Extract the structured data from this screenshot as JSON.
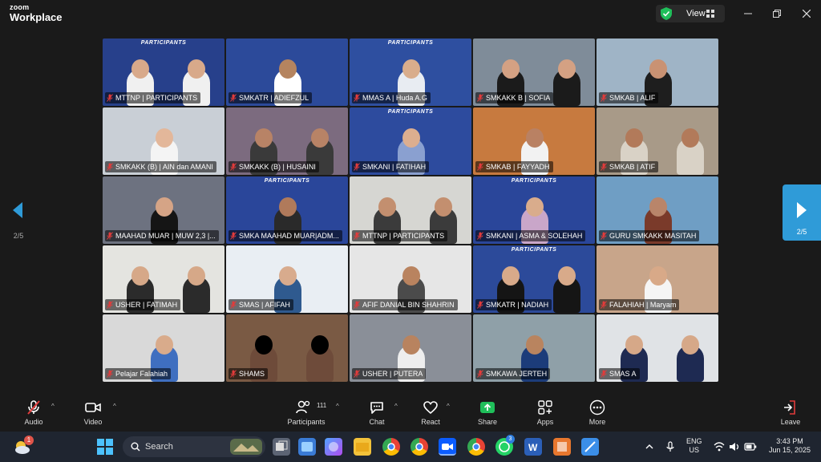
{
  "window": {
    "brand_top": "zoom",
    "brand_bottom": "Workplace",
    "view_label": "View",
    "colors": {
      "bg": "#1a1a1a",
      "accent": "#2f9bd8",
      "share": "#1fbf5a",
      "muted": "#e23b3b"
    }
  },
  "nav": {
    "left_count": "2/5",
    "right_count": "2/5"
  },
  "tiles": [
    {
      "name": "MTTNP | PARTICIPANTS",
      "bg": "#27408b",
      "skin": "#d8a98a",
      "wear": "#f0f0f0",
      "banner": "PARTICIPANTS"
    },
    {
      "name": "SMKATR | ADIEFZUL",
      "bg": "#2c4a9a",
      "skin": "#b5845f",
      "wear": "#ffffff",
      "banner": ""
    },
    {
      "name": "MMAS A | Huda A.G",
      "bg": "#2e4fa0",
      "skin": "#d9ad8c",
      "wear": "#e8ecf2",
      "banner": "PARTICIPANTS"
    },
    {
      "name": "SMKAKK B | SOFIA",
      "bg": "#7f8c99",
      "skin": "#d4a183",
      "wear": "#1b1b1b",
      "banner": ""
    },
    {
      "name": "SMKAB | ALIF",
      "bg": "#9fb4c6",
      "skin": "#c99273",
      "wear": "#1e1e1e",
      "banner": ""
    },
    {
      "name": "SMKAKK (B) | AIN dan AMANI",
      "bg": "#c9cfd6",
      "skin": "#e3b79a",
      "wear": "#f4f4f4",
      "banner": ""
    },
    {
      "name": "SMKAKK (B) | HUSAINI",
      "bg": "#7c6b7f",
      "skin": "#b88366",
      "wear": "#3a3a3a",
      "banner": ""
    },
    {
      "name": "SMKANI | FATIHAH",
      "bg": "#2d4b9e",
      "skin": "#dcae8f",
      "wear": "#8aa0d0",
      "banner": "PARTICIPANTS"
    },
    {
      "name": "SMKAB | FAYYADH",
      "bg": "#c77a3f",
      "skin": "#b98163",
      "wear": "#f2f2f2",
      "banner": ""
    },
    {
      "name": "SMKAB | ATIF",
      "bg": "#a89a88",
      "skin": "#b27a5a",
      "wear": "#d9d2c6",
      "banner": ""
    },
    {
      "name": "MAAHAD MUAR | MUW 2,3 |...",
      "bg": "#6d7280",
      "skin": "#d5a486",
      "wear": "#151515",
      "banner": ""
    },
    {
      "name": "SMKA MAAHAD MUAR|ADM...",
      "bg": "#2a469a",
      "skin": "#b07a5b",
      "wear": "#2a2a2a",
      "banner": "PARTICIPANTS"
    },
    {
      "name": "MTTNP | PARTICIPANTS",
      "bg": "#d6d6d2",
      "skin": "#c38f6f",
      "wear": "#3b3b3b",
      "banner": ""
    },
    {
      "name": "SMKANI | ASMA & SOLEHAH",
      "bg": "#2a469a",
      "skin": "#d9ac8c",
      "wear": "#c9a6c9",
      "banner": "PARTICIPANTS"
    },
    {
      "name": "GURU SMKAKK MASITAH",
      "bg": "#6f9ec4",
      "skin": "#b9856a",
      "wear": "#7a3a2a",
      "banner": ""
    },
    {
      "name": "USHER | FATIMAH",
      "bg": "#e4e4e0",
      "skin": "#d6a888",
      "wear": "#2b2b2b",
      "banner": ""
    },
    {
      "name": "SMAS | AFIFAH",
      "bg": "#e9eef3",
      "skin": "#d8ab8d",
      "wear": "#2f5a8f",
      "banner": ""
    },
    {
      "name": "AFIF DANIAL BIN SHAHRIN",
      "bg": "#e6e6e6",
      "skin": "#b9835f",
      "wear": "#4b4b4b",
      "banner": ""
    },
    {
      "name": "SMKATR | NADIAH",
      "bg": "#2c4a9a",
      "skin": "#d8aa8a",
      "wear": "#151515",
      "banner": "PARTICIPANTS"
    },
    {
      "name": "FALAHIAH | Maryam",
      "bg": "#c8a58a",
      "skin": "#d8a988",
      "wear": "#f5f5f5",
      "banner": ""
    },
    {
      "name": "Pelajar Falahiah",
      "bg": "#d9d9d9",
      "skin": "#d9ab8b",
      "wear": "#3f6fc0",
      "banner": ""
    },
    {
      "name": "SHAMS",
      "bg": "#7a5a44",
      "skin": "#000000",
      "wear": "#6e4b3a",
      "banner": ""
    },
    {
      "name": "USHER | PUTERA",
      "bg": "#8a8f98",
      "skin": "#b8835f",
      "wear": "#eeeeee",
      "banner": ""
    },
    {
      "name": "SMKAWA JERTEH",
      "bg": "#8fa0a8",
      "skin": "#b9845f",
      "wear": "#1c3c7a",
      "banner": ""
    },
    {
      "name": "SMAS A",
      "bg": "#e0e3e6",
      "skin": "#d6a888",
      "wear": "#1e2a52",
      "banner": ""
    }
  ],
  "toolbar": {
    "audio": "Audio",
    "video": "Video",
    "participants": "Participants",
    "participant_count": "111",
    "chat": "Chat",
    "react": "React",
    "share": "Share",
    "apps": "Apps",
    "more": "More",
    "leave": "Leave"
  },
  "taskbar": {
    "search_placeholder": "Search",
    "lang_top": "ENG",
    "lang_bottom": "US",
    "time": "3:43 PM",
    "date": "Jun 15, 2025",
    "weather_badge": "1",
    "whatsapp_badge": "3"
  }
}
